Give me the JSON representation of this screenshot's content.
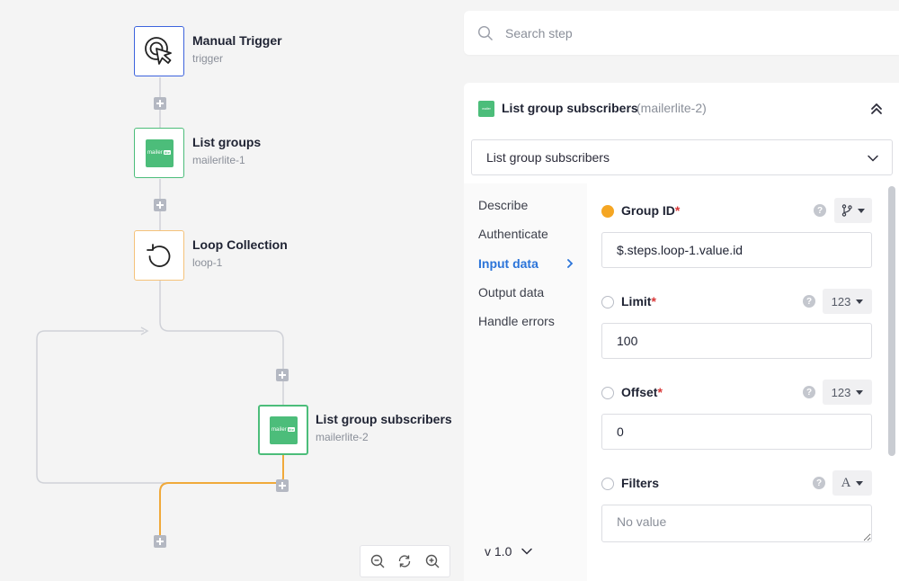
{
  "flow": {
    "nodes": [
      {
        "title": "Manual Trigger",
        "subtitle": "trigger",
        "icon": "cursor-click-icon",
        "border": "#3d63dd"
      },
      {
        "title": "List groups",
        "subtitle": "mailerlite-1",
        "icon": "mailerlite-logo",
        "border": "#4cbd7a"
      },
      {
        "title": "Loop Collection",
        "subtitle": "loop-1",
        "icon": "loop-arrow-icon",
        "border": "#f5c27a"
      },
      {
        "title": "List group subscribers",
        "subtitle": "mailerlite-2",
        "icon": "mailerlite-logo",
        "border": "#4cbd7a"
      }
    ],
    "logo_text": "mailer",
    "logo_badge": "lite",
    "colors": {
      "edge": "#d0d2d8",
      "active_edge": "#f0a93a",
      "plus": "#b4b8c2"
    }
  },
  "search": {
    "placeholder": "Search step"
  },
  "panel": {
    "title": "List group subscribers",
    "subtitle": "(mailerlite-2)",
    "action_selected": "List group subscribers",
    "nav": [
      {
        "label": "Describe",
        "active": false
      },
      {
        "label": "Authenticate",
        "active": false
      },
      {
        "label": "Input data",
        "active": true
      },
      {
        "label": "Output data",
        "active": false
      },
      {
        "label": "Handle errors",
        "active": false
      }
    ],
    "version": "v 1.0",
    "fields": [
      {
        "label": "Group ID",
        "required": "*",
        "type": "branch",
        "value": "$.steps.loop-1.value.id"
      },
      {
        "label": "Limit",
        "required": "*",
        "type": "123",
        "value": "100"
      },
      {
        "label": "Offset",
        "required": "*",
        "type": "123",
        "value": "0"
      },
      {
        "label": "Filters",
        "required": "",
        "type": "A",
        "placeholder": "No value"
      }
    ],
    "help_glyph": "?"
  }
}
